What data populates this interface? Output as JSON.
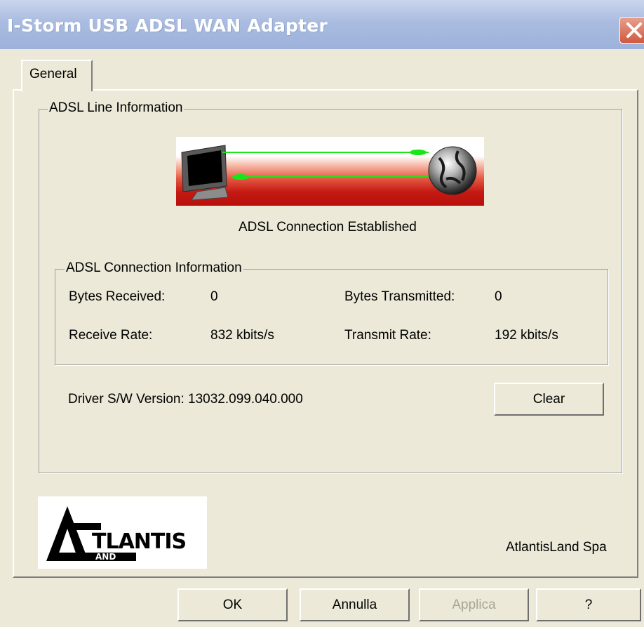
{
  "window": {
    "title": "I-Storm USB ADSL WAN Adapter"
  },
  "tabs": [
    {
      "label": "General",
      "active": true
    }
  ],
  "line_info": {
    "legend": "ADSL Line Information",
    "status": "ADSL Connection Established"
  },
  "connection_info": {
    "legend": "ADSL Connection Information",
    "bytes_received_label": "Bytes Received:",
    "bytes_received_value": "0",
    "bytes_transmitted_label": "Bytes Transmitted:",
    "bytes_transmitted_value": "0",
    "receive_rate_label": "Receive Rate:",
    "receive_rate_value": "832 kbits/s",
    "transmit_rate_label": "Transmit Rate:",
    "transmit_rate_value": "192 kbits/s"
  },
  "driver": {
    "label": "Driver S/W Version: 13032.099.040.000"
  },
  "clear_label": "Clear",
  "logo": {
    "text_main": "TLANTIS",
    "text_sub": "AND"
  },
  "company": "AtlantisLand Spa",
  "footer": {
    "ok": "OK",
    "cancel": "Annulla",
    "apply": "Applica",
    "help": "?"
  },
  "colors": {
    "titlebar": "#a9bbe0",
    "face": "#ece9d8",
    "link_green": "#19e619"
  }
}
